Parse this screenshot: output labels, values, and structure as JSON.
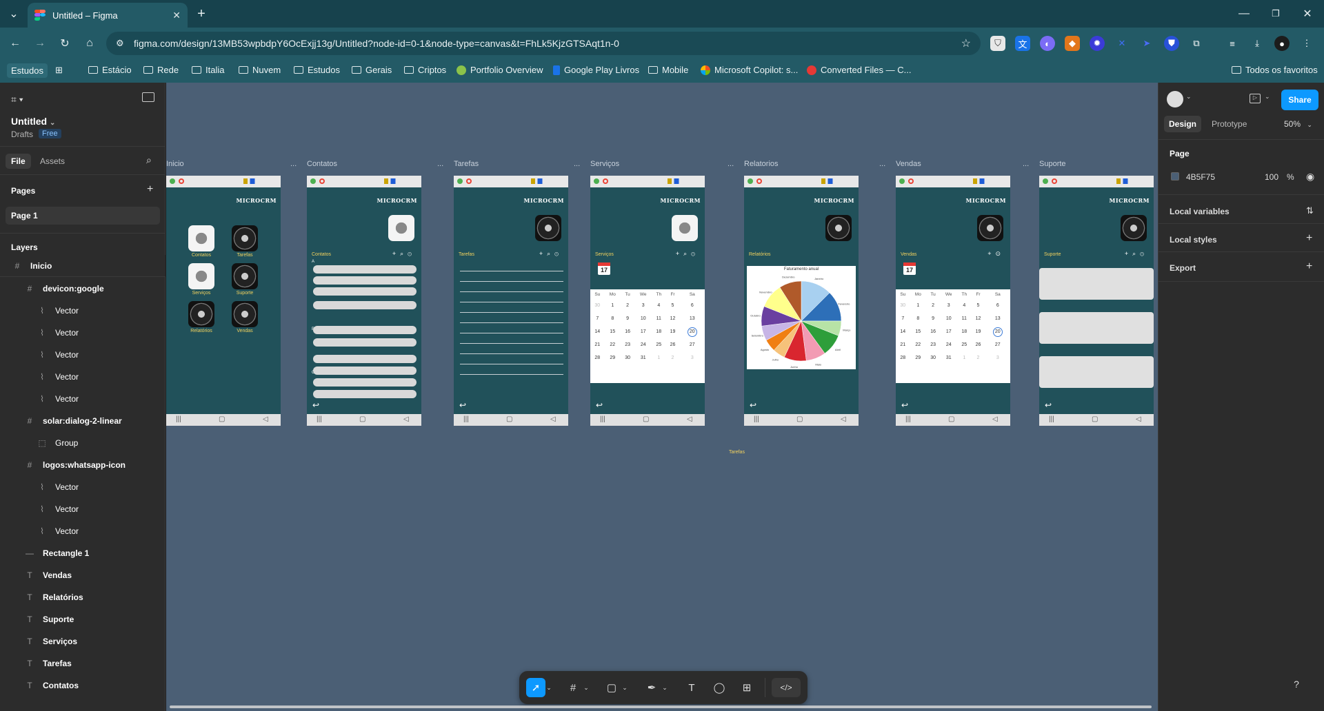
{
  "browser": {
    "tab_title": "Untitled – Figma",
    "url": "figma.com/design/13MB53wpbdpY6OcExjj13g/Untitled?node-id=0-1&node-type=canvas&t=FhLk5KjzGTSAqt1n-0",
    "bookmarks": [
      "Estudos",
      "Estácio",
      "Rede",
      "Italia",
      "Nuvem",
      "Estudos",
      "Gerais",
      "Criptos",
      "Portfolio Overview",
      "Google Play Livros",
      "Mobile",
      "Microsoft Copilot: s...",
      "Converted Files — C...",
      "Todos os favoritos"
    ]
  },
  "left_panel": {
    "file_name": "Untitled",
    "drafts": "Drafts",
    "plan": "Free",
    "tab_file": "File",
    "tab_assets": "Assets",
    "pages_title": "Pages",
    "page_1": "Page 1",
    "layers_title": "Layers",
    "layers": [
      {
        "name": "Inicio",
        "icon": "frame-icon",
        "level": 0
      },
      {
        "name": "Group",
        "icon": "group-icon",
        "level": 2
      },
      {
        "name": "devicon:google",
        "icon": "frame-icon",
        "level": 1
      },
      {
        "name": "Vector",
        "icon": "vector-icon",
        "level": 2
      },
      {
        "name": "Vector",
        "icon": "vector-icon",
        "level": 2
      },
      {
        "name": "Vector",
        "icon": "vector-icon",
        "level": 2
      },
      {
        "name": "Vector",
        "icon": "vector-icon",
        "level": 2
      },
      {
        "name": "Vector",
        "icon": "vector-icon",
        "level": 2
      },
      {
        "name": "solar:dialog-2-linear",
        "icon": "frame-icon",
        "level": 1
      },
      {
        "name": "Group",
        "icon": "group-icon",
        "level": 2
      },
      {
        "name": "logos:whatsapp-icon",
        "icon": "frame-icon",
        "level": 1
      },
      {
        "name": "Vector",
        "icon": "vector-icon",
        "level": 2
      },
      {
        "name": "Vector",
        "icon": "vector-icon",
        "level": 2
      },
      {
        "name": "Vector",
        "icon": "vector-icon",
        "level": 2
      },
      {
        "name": "Rectangle 1",
        "icon": "rectangle-icon",
        "level": 1
      },
      {
        "name": "Vendas",
        "icon": "text-icon",
        "level": 1
      },
      {
        "name": "Relatórios",
        "icon": "text-icon",
        "level": 1
      },
      {
        "name": "Suporte",
        "icon": "text-icon",
        "level": 1
      },
      {
        "name": "Serviços",
        "icon": "text-icon",
        "level": 1
      },
      {
        "name": "Tarefas",
        "icon": "text-icon",
        "level": 1
      },
      {
        "name": "Contatos",
        "icon": "text-icon",
        "level": 1
      }
    ]
  },
  "canvas": {
    "frames": [
      "Inicio",
      "Contatos",
      "Tarefas",
      "Serviços",
      "Relatorios",
      "Vendas",
      "Suporte"
    ],
    "brand": "MICROCRM",
    "home_labels": [
      "Contatos",
      "Tarefas",
      "Serviços",
      "Suporte",
      "Relatórios",
      "Vendas"
    ],
    "section_titles": {
      "contatos": "Contatos",
      "tarefas": "Tarefas",
      "servicos": "Serviços",
      "relatorios": "Relatórios",
      "vendas": "Vendas",
      "suporte": "Suporte"
    },
    "letters": [
      "A",
      "B",
      "C"
    ],
    "weekdays": [
      "Su",
      "Mo",
      "Tu",
      "We",
      "Th",
      "Fr",
      "Sa"
    ],
    "calendar_rows": [
      [
        "30",
        "1",
        "2",
        "3",
        "4",
        "5",
        "6"
      ],
      [
        "7",
        "8",
        "9",
        "10",
        "11",
        "12",
        "13"
      ],
      [
        "14",
        "15",
        "16",
        "17",
        "18",
        "19",
        "20"
      ],
      [
        "21",
        "22",
        "23",
        "24",
        "25",
        "26",
        "27"
      ],
      [
        "28",
        "29",
        "30",
        "31",
        "1",
        "2",
        "3"
      ]
    ],
    "calendar_icon_day": "17",
    "chart_title": "Faturamento anual",
    "floating_text": "Tarefas"
  },
  "chart_data": {
    "type": "pie",
    "title": "Faturamento anual",
    "categories": [
      "Janeiro",
      "Fevereiro",
      "Março",
      "Abril",
      "Maio",
      "Junho",
      "Julho",
      "Agosto",
      "Setembro",
      "Outubro",
      "Novembro",
      "Dezembro"
    ],
    "values": [
      12.5,
      12.5,
      6,
      9,
      8,
      9,
      5,
      5,
      6,
      8,
      10,
      9
    ],
    "colors": [
      "#a8d0f0",
      "#2d6fb8",
      "#b7e3a6",
      "#2e9e3a",
      "#f29bb3",
      "#d9262f",
      "#f6c27a",
      "#f07f13",
      "#c7b5e6",
      "#6a3fa0",
      "#ffff8c",
      "#b05a2a"
    ]
  },
  "right_panel": {
    "share": "Share",
    "tab_design": "Design",
    "tab_prototype": "Prototype",
    "zoom": "50%",
    "page_title": "Page",
    "page_color": "4B5F75",
    "opacity": "100",
    "percent": "%",
    "local_variables": "Local variables",
    "local_styles": "Local styles",
    "export": "Export"
  }
}
